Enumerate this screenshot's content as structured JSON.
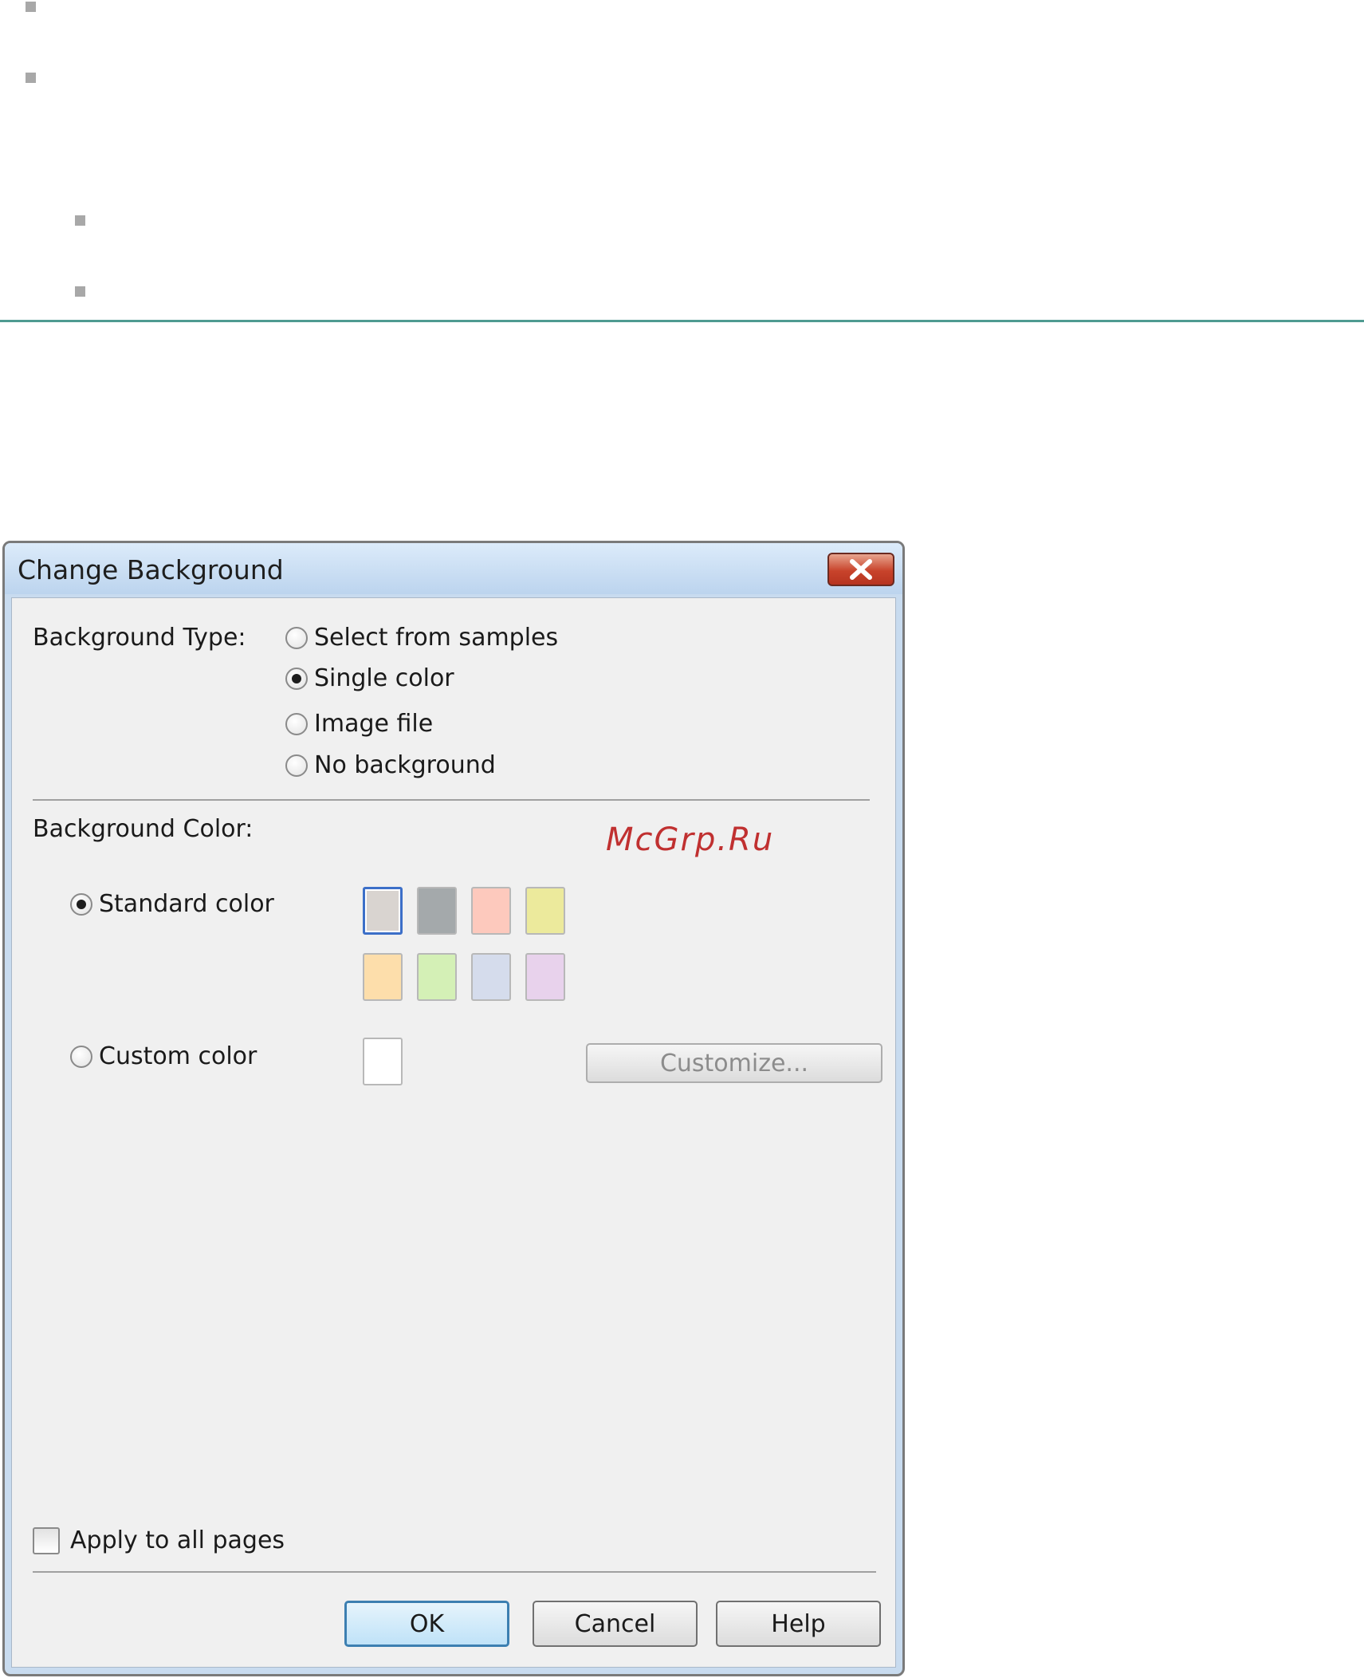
{
  "dialog": {
    "title": "Change Background",
    "background_type_label": "Background Type:",
    "background_type_options": [
      {
        "label": "Select from samples",
        "checked": false
      },
      {
        "label": "Single color",
        "checked": true
      },
      {
        "label": "Image file",
        "checked": false
      },
      {
        "label": "No background",
        "checked": false
      }
    ],
    "background_color_label": "Background Color:",
    "standard_color": {
      "label": "Standard color",
      "checked": true
    },
    "custom_color": {
      "label": "Custom color",
      "checked": false
    },
    "customize_button": "Customize...",
    "swatches": [
      "#d9d4d0",
      "#a4a9ab",
      "#fdc9bd",
      "#ecea9c",
      "#fddeab",
      "#d4f0b6",
      "#d5dcec",
      "#e8d2ec"
    ],
    "selected_swatch": 0,
    "custom_swatch_color": "#ffffff",
    "apply_all_pages": {
      "label": "Apply to all pages",
      "checked": false
    },
    "buttons": {
      "ok": "OK",
      "cancel": "Cancel",
      "help": "Help"
    }
  },
  "watermark": "McGrp.Ru"
}
